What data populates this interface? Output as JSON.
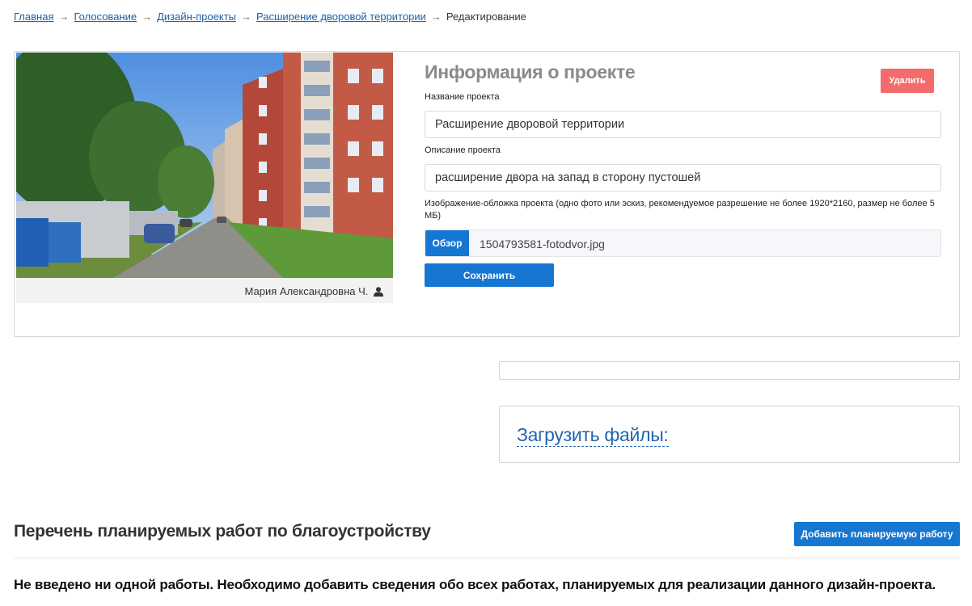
{
  "breadcrumb": {
    "items": [
      {
        "label": "Главная"
      },
      {
        "label": "Голосование"
      },
      {
        "label": "Дизайн-проекты"
      },
      {
        "label": "Расширение дворовой территории"
      }
    ],
    "separator": "→",
    "current": "Редактирование"
  },
  "project": {
    "photo_author": "Мария Александровна Ч.",
    "info_title": "Информация о проекте",
    "delete_label": "Удалить",
    "name_label": "Название проекта",
    "name_value": "Расширение дворовой территории",
    "description_label": "Описание проекта",
    "description_value": "расширение двора на запад в сторону пустошей",
    "cover_hint": "Изображение-обложка проекта (одно фото или эскиз, рекомендуемое разрешение не более 1920*2160, размер не более 5 МБ)",
    "browse_label": "Обзор",
    "file_name": "1504793581-fotodvor.jpg",
    "save_label": "Сохранить"
  },
  "upload": {
    "title": "Загрузить файлы:"
  },
  "works": {
    "title": "Перечень планируемых работ по благоустройству",
    "add_label": "Добавить планируемую работу",
    "empty_message": "Не введено ни одной работы. Необходимо добавить сведения обо всех работах, планируемых для реализации данного дизайн-проекта."
  },
  "colors": {
    "link": "#1a5fa6",
    "primary": "#1677d2",
    "danger": "#f46b6b",
    "title_gray": "#8a8a8a"
  }
}
